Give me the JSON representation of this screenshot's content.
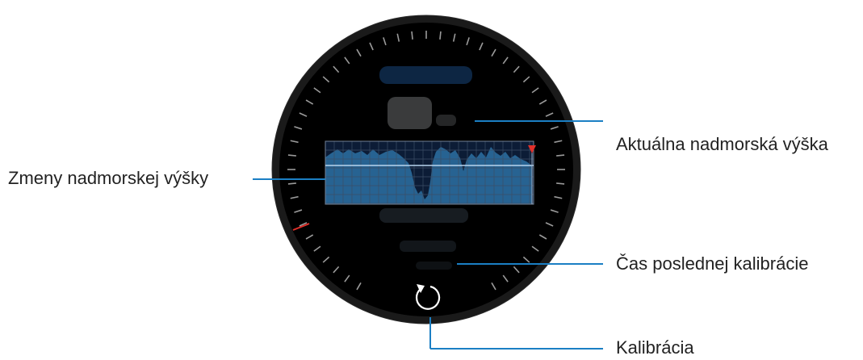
{
  "callouts": {
    "current_altitude": "Aktuálna nadmorská výška",
    "altitude_changes": "Zmeny nadmorskej výšky",
    "last_calibration_time": "Čas poslednej kalibrácie",
    "calibration": "Kalibrácia"
  },
  "watch": {
    "bezel_color": "#1a1a1a",
    "face_color": "#000000",
    "tick_color": "#9a9a9a",
    "marker_color": "#e0302a",
    "callout_line_color": "#1b7fc4",
    "calibrate_icon": "refresh-icon"
  },
  "graph": {
    "fill_color": "#2a6c9c",
    "grid_color": "#3d4e66",
    "reference_line_color": "#b8d4ee",
    "marker_color": "#e0302a",
    "current_marker_icon": "triangle-down-icon"
  }
}
